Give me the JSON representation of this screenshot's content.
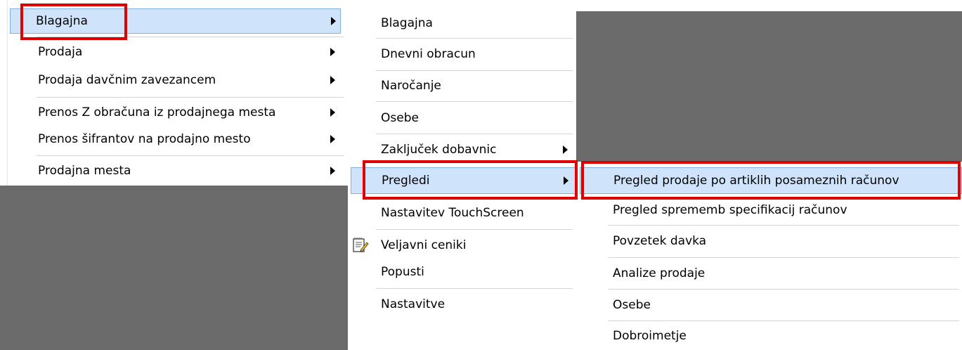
{
  "menu1": {
    "items": [
      "Blagajna",
      "Prodaja",
      "Prodaja davčnim zavezancem",
      "Prenos Z obračuna iz prodajnega mesta",
      "Prenos šifrantov na prodajno mesto",
      "Prodajna mesta"
    ]
  },
  "menu2": {
    "items": [
      "Blagajna",
      "Dnevni obracun",
      "Naročanje",
      "Osebe",
      "Zaključek dobavnic",
      "Pregledi",
      "Nastavitev TouchScreen",
      "Veljavni ceniki",
      "Popusti",
      "Nastavitve"
    ]
  },
  "menu3": {
    "items": [
      "Pregled prodaje po artiklih posameznih računov",
      "Pregled sprememb specifikacij računov",
      "Povzetek davka",
      "Analize prodaje",
      "Osebe",
      "Dobroimetje"
    ]
  },
  "icons": {
    "notepad": "notepad-pencil-icon",
    "submenu": "submenu-arrow-icon"
  },
  "colors": {
    "highlight": "#cfe4fb",
    "annotation": "#e10000",
    "background": "#6b6b6b"
  }
}
